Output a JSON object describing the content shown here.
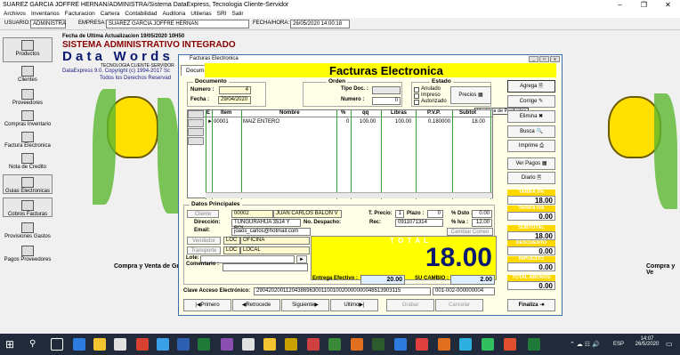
{
  "window": {
    "title": "SUAREZ GARCIA JOFFRE HERNAN/ADMINISTRA/Sistema DataExpress, Tecnologia Cliente-Servidor"
  },
  "menu": [
    "Archivos",
    "Inventarios",
    "Facturacion",
    "Cartera",
    "Contabilidad",
    "Auditoria",
    "Utilerias",
    "SRI",
    "Salir"
  ],
  "userbar": {
    "usuario_label": "USUARIO:",
    "usuario": "ADMINISTRA",
    "empresa_label": "EMPRESA:",
    "empresa": "SUAREZ GARCIA JOFFRE HERNAN",
    "fecha_label": "FECHA/HORA:",
    "fecha": "26/05/2020 14:00:18"
  },
  "header": {
    "update": "Fecha de Ultima Actualizacion 19/05/2020 10H50",
    "title": "SISTEMA ADMINISTRATIVO INTEGRADO",
    "brand": "D a t a   W o r d s",
    "tech": "TECNOLOGIA CLIENTE-SERVIDOR",
    "copyright": "DataExpress 9.0. Copyright (c) 1994-2017 Sc",
    "rights": "Todos los Derechos Reservad",
    "compra": "Compra y Venta de Gra",
    "compra_right": "Compra y Ve"
  },
  "sidebar": [
    "Productos",
    "Clientes",
    "Proveedores",
    "Compras Inventario",
    "Factura Electronica",
    "Nota de Credito",
    "Guias Electronicas",
    "Cobros Facturas",
    "Provisiones Gastos",
    "Pagos Proveedores"
  ],
  "dialog": {
    "title": "Facturas Electronica",
    "tab": "Documento",
    "heading": "Facturas Electronica",
    "documento": {
      "group": "Documento",
      "numero_label": "Numero :",
      "numero": "4",
      "fecha_label": "Fecha :",
      "fecha": "29/04/2020"
    },
    "orden": {
      "group": "Orden",
      "tipo_label": "Tipo Doc. :",
      "numero_label": "Numero :",
      "numero": "0"
    },
    "estado": {
      "group": "Estado",
      "anulado": "Anulado",
      "impreso": "Impreso",
      "autorizado": "Autorizado"
    },
    "precios_button": "Precios",
    "tooltip": "Ver Lista de Productos",
    "grid": {
      "columns": [
        "E",
        "Item",
        "Nombre",
        "%",
        "qq",
        "Libras",
        "P.V.P.",
        "Subtot"
      ],
      "rows": [
        {
          "item": "00001",
          "nombre": "MAIZ ENTERO",
          "pct": "0",
          "qq": "100.00",
          "libras": "100.00",
          "pvp": "0.180000",
          "subtot": "18.00"
        }
      ]
    },
    "datos": {
      "group": "Datos Principales",
      "cliente_button": "Cliente",
      "cliente_code": "00002",
      "cliente_name": "JUAN CARLOS BALON V",
      "direccion_label": "Dirección:",
      "direccion": "TUNGURAHUA 3514 Y BOL",
      "despacho_label": "No. Despacho:",
      "email_label": "Email:",
      "email": "joaos_carlos@hotmail.com",
      "tprecio_label": "T. Precio:",
      "tprecio": "1",
      "plazo_label": "Plazo :",
      "plazo": "0",
      "dsto_label": "% Dsto :",
      "dsto": "0.00",
      "rec_label": "Rec:",
      "rec": "0911071314",
      "iva_label": "% Iva :",
      "iva": "12.00",
      "cambiar_correo": "Cambiar Correo",
      "vendedor_button": "Vendedor",
      "vendedor_code": "LOC",
      "vendedor_name": "OFICINA",
      "transporte_button": "Transporte",
      "transporte_code": "LOC",
      "transporte_name": "LOCAL",
      "lote_label": "Lote:",
      "comentario_label": "Comentario :"
    },
    "total": {
      "label": "T O T A L",
      "value": "18.00",
      "entrega_label": "Entrega Efectivo :",
      "entrega": "20.00",
      "cambio_label": "SU CAMBIO :",
      "cambio": "2.00"
    },
    "clave": {
      "label": "Clave Acceso Electrónico:",
      "value": "2904202001120438696300110010020000000048513903115",
      "serie": "001-002-000000004"
    },
    "nav": {
      "primero": "Primero",
      "retrocede": "Retrocede",
      "siguiente": "Siguiente",
      "ultimo": "Ultimo",
      "grabar": "Grabar",
      "cancelar": "Cancelar",
      "finaliza": "Finaliza"
    },
    "side_buttons": {
      "agrega": "Agrega",
      "corrige": "Corrige",
      "elimina": "Elimina",
      "busca": "Busca",
      "imprime": "Imprime",
      "ver_pagos": "Ver Pagos",
      "diario": "Diario"
    },
    "summary": [
      {
        "label": "TARIFA 0%",
        "value": "18.00"
      },
      {
        "label": "TARIFA IVA",
        "value": "0.00"
      },
      {
        "label": "SUBTOTAL",
        "value": "18.00"
      },
      {
        "label": "DESCUENTO",
        "value": "0.00"
      },
      {
        "label": "IMPUESTO",
        "value": "0.00"
      },
      {
        "label": "TOTAL ABONOS",
        "value": "0.00"
      }
    ]
  },
  "taskbar": {
    "lang": "ESP",
    "time": "14:07",
    "date": "26/5/2020"
  },
  "colors": {
    "accent_yellow": "#ffff00",
    "title_blue": "#3a6fb0"
  }
}
